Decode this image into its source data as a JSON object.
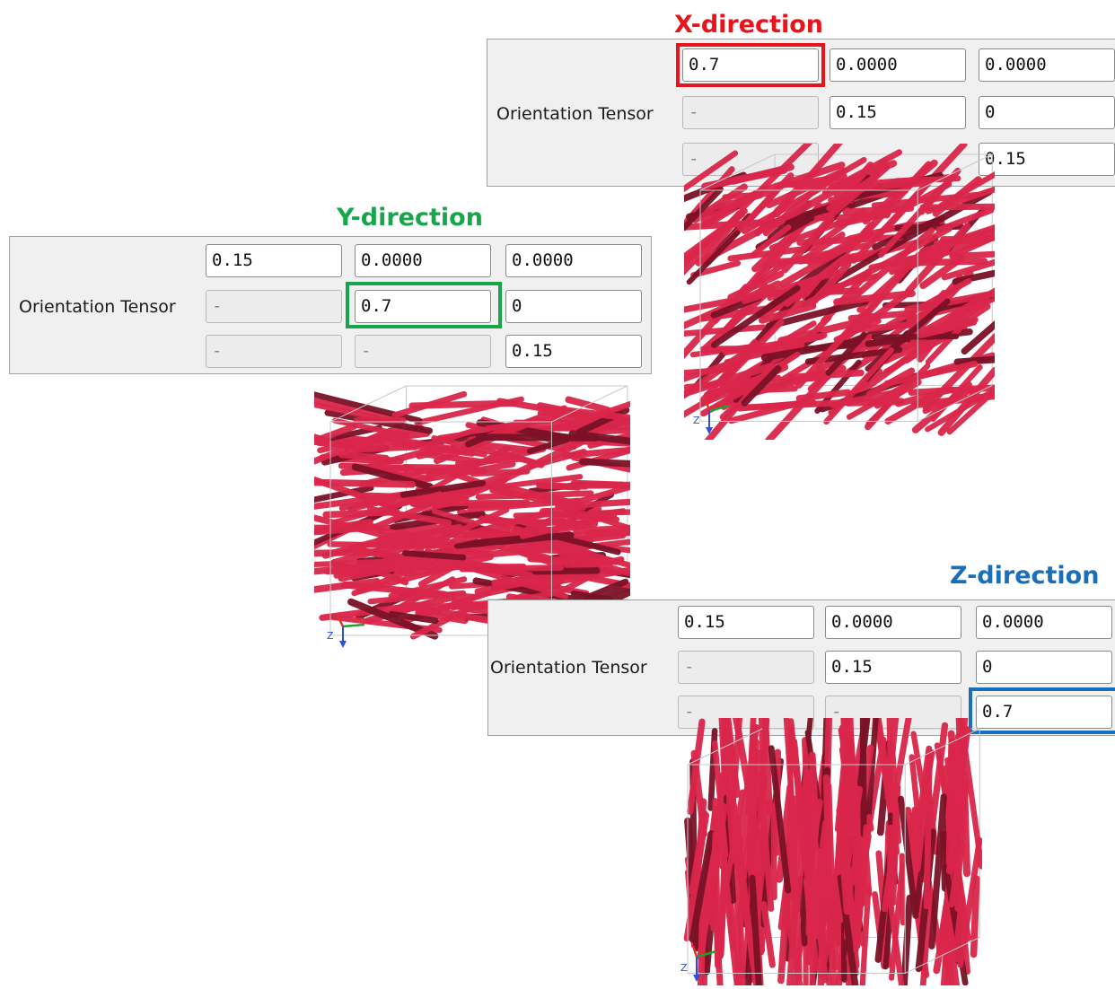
{
  "panels": {
    "x": {
      "title": "X-direction",
      "title_color": "#e8141c",
      "label": "Orientation Tensor",
      "rows": [
        [
          "0.7",
          "0.0000",
          "0.0000"
        ],
        [
          "-",
          "0.15",
          "0"
        ],
        [
          "-",
          "",
          "0.15"
        ]
      ],
      "highlight_color": "#e8141c"
    },
    "y": {
      "title": "Y-direction",
      "title_color": "#18a64a",
      "label": "Orientation Tensor",
      "rows": [
        [
          "0.15",
          "0.0000",
          "0.0000"
        ],
        [
          "-",
          "0.7",
          "0"
        ],
        [
          "-",
          "-",
          "0.15"
        ]
      ],
      "highlight_color": "#18a64a"
    },
    "z": {
      "title": "Z-direction",
      "title_color": "#1a6fb8",
      "label": "Orientation Tensor",
      "rows": [
        [
          "0.15",
          "0.0000",
          "0.0000"
        ],
        [
          "-",
          "0.15",
          "0"
        ],
        [
          "-",
          "-",
          "0.7"
        ]
      ],
      "highlight_color": "#1a6fb8"
    }
  },
  "colors": {
    "fiber": "#d9264a",
    "fiber_dark": "#7a1126",
    "panel_bg": "#f0f0f0"
  },
  "icons": {
    "axis_triad": "axis-triad-icon",
    "z_axis_label": "Z"
  }
}
